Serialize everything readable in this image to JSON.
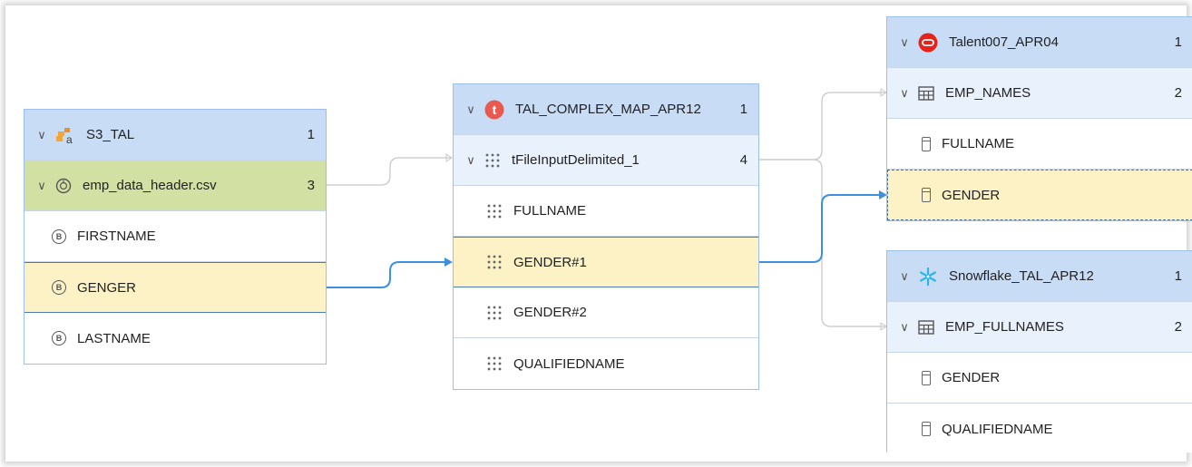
{
  "source_panel": {
    "header": {
      "label": "S3_TAL",
      "count": "1",
      "icon": "aws-s3-icon"
    },
    "file": {
      "label": "emp_data_header.csv",
      "count": "3",
      "icon": "file-format-icon"
    },
    "fields": [
      {
        "label": "FIRSTNAME",
        "icon": "binary-field-icon"
      },
      {
        "label": "GENGER",
        "icon": "binary-field-icon",
        "highlighted": true
      },
      {
        "label": "LASTNAME",
        "icon": "binary-field-icon"
      }
    ]
  },
  "mapping_panel": {
    "header": {
      "label": "TAL_COMPLEX_MAP_APR12",
      "count": "1",
      "icon": "talend-icon",
      "icon_letter": "t"
    },
    "component": {
      "label": "tFileInputDelimited_1",
      "count": "4",
      "icon": "grid-dots-icon"
    },
    "fields": [
      {
        "label": "FULLNAME"
      },
      {
        "label": "GENDER#1",
        "highlighted": true
      },
      {
        "label": "GENDER#2"
      },
      {
        "label": "QUALIFIEDNAME"
      }
    ]
  },
  "target_oracle": {
    "header": {
      "label": "Talent007_APR04",
      "count": "1",
      "icon": "oracle-icon"
    },
    "table": {
      "label": "EMP_NAMES",
      "count": "2",
      "icon": "table-icon"
    },
    "columns": [
      {
        "label": "FULLNAME"
      },
      {
        "label": "GENDER",
        "highlighted": true
      }
    ]
  },
  "target_snowflake": {
    "header": {
      "label": "Snowflake_TAL_APR12",
      "count": "1",
      "icon": "snowflake-icon"
    },
    "table": {
      "label": "EMP_FULLNAMES",
      "count": "2",
      "icon": "table-icon"
    },
    "columns": [
      {
        "label": "GENDER"
      },
      {
        "label": "QUALIFIEDNAME"
      }
    ]
  },
  "colors": {
    "header_bg": "#c9dcf6",
    "subheader_bg": "#e9f1fc",
    "file_bg": "#d3e0a4",
    "highlight_bg": "#fcf2c6",
    "lineage_active": "#3d8fe0",
    "lineage_inactive": "#c8c8c8"
  }
}
